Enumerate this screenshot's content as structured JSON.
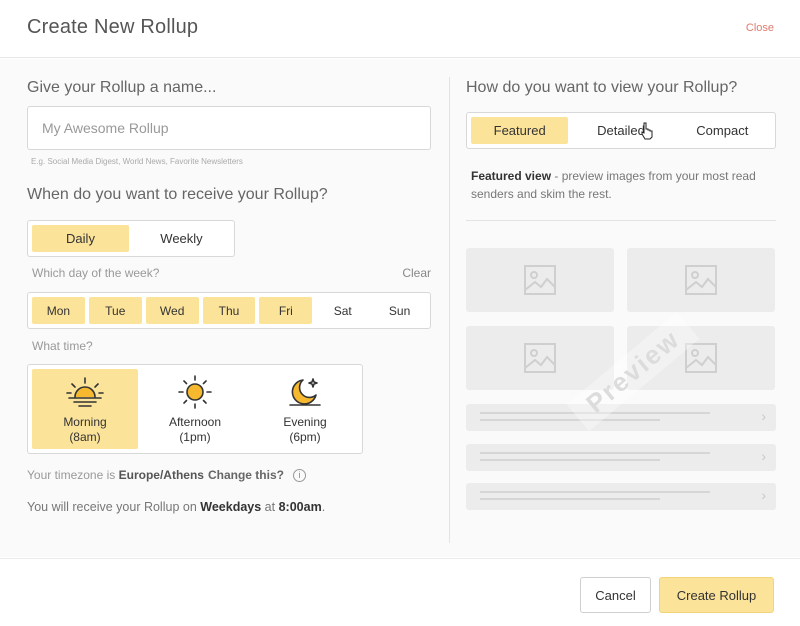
{
  "header": {
    "title": "Create New Rollup",
    "close_label": "Close"
  },
  "left": {
    "name_label": "Give your Rollup a name...",
    "name_placeholder": "My Awesome Rollup",
    "name_hint": "E.g. Social Media Digest, World News, Favorite Newsletters",
    "receive_label": "When do you want to receive your Rollup?",
    "frequency": [
      {
        "label": "Daily",
        "selected": true
      },
      {
        "label": "Weekly",
        "selected": false
      }
    ],
    "day_label": "Which day of the week?",
    "clear_label": "Clear",
    "days": [
      {
        "label": "Mon",
        "selected": true
      },
      {
        "label": "Tue",
        "selected": true
      },
      {
        "label": "Wed",
        "selected": true
      },
      {
        "label": "Thu",
        "selected": true
      },
      {
        "label": "Fri",
        "selected": true
      },
      {
        "label": "Sat",
        "selected": false
      },
      {
        "label": "Sun",
        "selected": false
      }
    ],
    "time_label": "What time?",
    "times": [
      {
        "line1": "Morning",
        "line2": "(8am)",
        "icon": "sunrise-icon",
        "selected": true
      },
      {
        "line1": "Afternoon",
        "line2": "(1pm)",
        "icon": "sun-icon",
        "selected": false
      },
      {
        "line1": "Evening",
        "line2": "(6pm)",
        "icon": "moon-icon",
        "selected": false
      }
    ],
    "timezone_prefix": "Your timezone is",
    "timezone_value": "Europe/Athens",
    "timezone_change": "Change this?",
    "summary_prefix": "You will receive your Rollup on",
    "summary_days": "Weekdays",
    "summary_mid": "at",
    "summary_time": "8:00am",
    "summary_suffix": "."
  },
  "right": {
    "view_label": "How do you want to view your Rollup?",
    "views": [
      {
        "label": "Featured",
        "selected": true
      },
      {
        "label": "Detailed",
        "selected": false
      },
      {
        "label": "Compact",
        "selected": false
      }
    ],
    "desc_bold": "Featured view",
    "desc_rest": " - preview images from your most read senders and skim the rest.",
    "watermark": "Preview"
  },
  "footer": {
    "cancel_label": "Cancel",
    "create_label": "Create Rollup"
  },
  "colors": {
    "accent": "#fbe39a",
    "close": "#e07a6f",
    "placeholder_gray": "#ececec"
  }
}
